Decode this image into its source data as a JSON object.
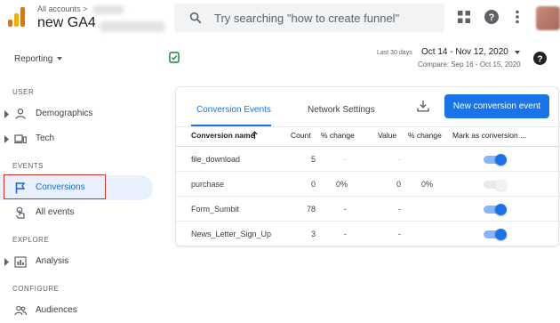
{
  "topbar": {
    "account_crumb": "All accounts >",
    "property_name": "new GA4",
    "search_placeholder": "Try searching \"how to create funnel\""
  },
  "subheader": {
    "reporting_label": "Reporting",
    "date_preset": "Last 30 days",
    "date_range": "Oct 14 - Nov 12, 2020",
    "compare": "Compare: Sep 16 - Oct 15, 2020"
  },
  "sidebar": {
    "sections": {
      "user": "USER",
      "events": "EVENTS",
      "explore": "EXPLORE",
      "configure": "CONFIGURE"
    },
    "items": {
      "demographics": "Demographics",
      "tech": "Tech",
      "conversions": "Conversions",
      "all_events": "All events",
      "analysis": "Analysis",
      "audiences": "Audiences"
    }
  },
  "card": {
    "tabs": {
      "conversion_events": "Conversion Events",
      "network_settings": "Network Settings"
    },
    "new_button": "New conversion event",
    "headers": {
      "name": "Conversion name",
      "count": "Count",
      "pct_change": "% change",
      "value": "Value",
      "value_pct_change": "% change",
      "mark": "Mark as conversion ..."
    },
    "rows": [
      {
        "name": "file_download",
        "count": "5",
        "pct": "-",
        "value": "-",
        "value_pct": "",
        "enabled": true
      },
      {
        "name": "purchase",
        "count": "0",
        "pct": "0%",
        "value": "0",
        "value_pct": "0%",
        "enabled": false
      },
      {
        "name": "Form_Sumbit",
        "count": "78",
        "pct": "-",
        "value": "-",
        "value_pct": "",
        "enabled": true
      },
      {
        "name": "News_Letter_Sign_Up",
        "count": "3",
        "pct": "-",
        "value": "-",
        "value_pct": "",
        "enabled": true
      }
    ]
  },
  "colors": {
    "accent": "#1a73e8",
    "active_nav_bg": "#e8f0fe",
    "highlight_outline": "#d93025",
    "logo_orange": "#e37400",
    "logo_yellow": "#f9ab00"
  },
  "icons": [
    "analytics-logo",
    "search-icon",
    "apps-grid-icon",
    "help-icon",
    "more-vert-icon",
    "check-file-icon",
    "chevron-right-icon",
    "person-icon",
    "devices-icon",
    "flag-icon",
    "touch-icon",
    "analysis-icon",
    "audiences-icon",
    "download-icon",
    "sort-up-icon"
  ]
}
